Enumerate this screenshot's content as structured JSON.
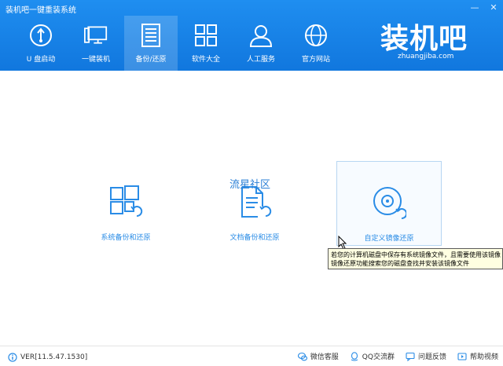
{
  "window": {
    "title": "装机吧一键重装系统",
    "min_symbol": "—",
    "close_symbol": "✕"
  },
  "nav": {
    "items": [
      {
        "label": "U 盘启动",
        "icon": "usb-icon"
      },
      {
        "label": "一键装机",
        "icon": "monitor-icon"
      },
      {
        "label": "备份/还原",
        "icon": "backup-icon",
        "active": true
      },
      {
        "label": "软件大全",
        "icon": "grid-icon"
      },
      {
        "label": "人工服务",
        "icon": "user-icon"
      },
      {
        "label": "官方网站",
        "icon": "globe-icon"
      }
    ]
  },
  "logo": {
    "text": "装机吧",
    "url_text": "zhuangjiba.com"
  },
  "options": [
    {
      "label": "系统备份和还原",
      "icon": "windows-restore-icon"
    },
    {
      "label": "文档备份和还原",
      "icon": "document-restore-icon"
    },
    {
      "label": "自定义镜像还原",
      "icon": "disc-restore-icon",
      "hovered": true
    }
  ],
  "watermark": "流星社区",
  "tooltip": {
    "line1": "若您的计算机磁盘中保存有系统镜像文件，且需要使用该镜像",
    "line2": "镜像还原功能搜索您的磁盘查找并安装该镜像文件"
  },
  "footer": {
    "version": "VER[11.5.47.1530]",
    "links": [
      {
        "label": "微信客服",
        "icon": "wechat-icon"
      },
      {
        "label": "QQ交流群",
        "icon": "qq-icon"
      },
      {
        "label": "问题反馈",
        "icon": "feedback-icon"
      },
      {
        "label": "帮助视频",
        "icon": "play-icon"
      }
    ]
  },
  "colors": {
    "header_blue": "#1480e6",
    "accent_blue": "#2a8ce6"
  }
}
